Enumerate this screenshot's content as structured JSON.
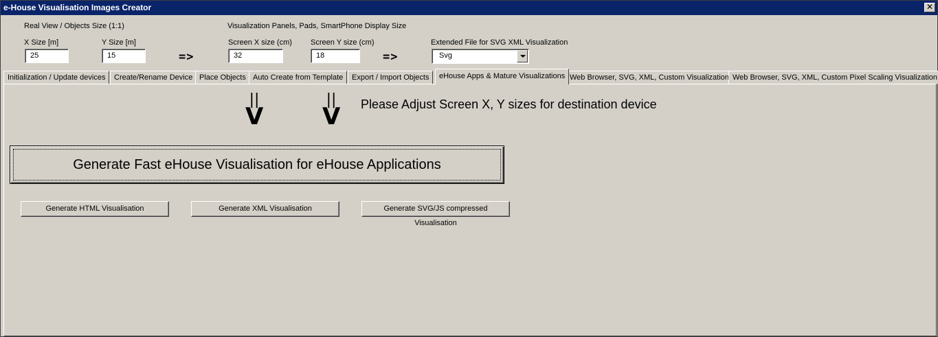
{
  "window": {
    "title": "e-House Visualisation Images Creator",
    "close_glyph": "✕"
  },
  "real_view": {
    "heading": "Real View / Objects Size (1:1)",
    "x_label": "X Size [m]",
    "x_value": "25",
    "y_label": "Y Size [m]",
    "y_value": "15"
  },
  "display": {
    "heading": "Visualization Panels, Pads, SmartPhone Display Size",
    "x_label": "Screen X size (cm)",
    "x_value": "32",
    "y_label": "Screen Y size (cm)",
    "y_value": "18"
  },
  "arrows": {
    "right1": "=>",
    "right2": "=>",
    "bars": "||",
    "v": "V"
  },
  "extended": {
    "label": "Extended File for SVG XML Visualization",
    "selected": "Svg"
  },
  "tabs": [
    {
      "label": "Initialization / Update devices"
    },
    {
      "label": "Create/Rename Device"
    },
    {
      "label": "Place Objects"
    },
    {
      "label": "Auto Create from Template"
    },
    {
      "label": "Export / Import Objects"
    },
    {
      "label": "eHouse Apps & Mature Visualizations"
    },
    {
      "label": "Web Browser, SVG, XML, Custom Visualizations"
    },
    {
      "label": "Web Browser, SVG, XML, Custom Pixel Scaling Visualization"
    }
  ],
  "panel": {
    "hint": "Please Adjust Screen X, Y sizes for destination device",
    "big_button": "Generate Fast eHouse Visualisation for eHouse Applications",
    "html_button": "Generate HTML Visualisation",
    "xml_button": "Generate XML Visualisation",
    "svg_button": "Generate SVG/JS compressed Visualisation"
  },
  "colors": {
    "titlebar": "#0a246a",
    "face": "#d4d0c8"
  }
}
